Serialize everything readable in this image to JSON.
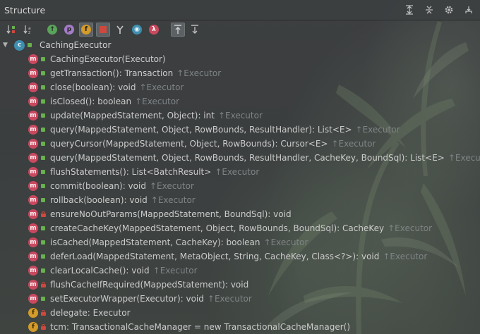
{
  "panel": {
    "title": "Structure"
  },
  "root": {
    "name": "CachingExecutor"
  },
  "members": [
    {
      "kind": "m",
      "visibility": "public",
      "signature": "CachingExecutor(Executor)",
      "inherited": ""
    },
    {
      "kind": "m",
      "visibility": "public",
      "signature": "getTransaction(): Transaction",
      "inherited": "↑Executor"
    },
    {
      "kind": "m",
      "visibility": "public",
      "signature": "close(boolean): void",
      "inherited": "↑Executor"
    },
    {
      "kind": "m",
      "visibility": "public",
      "signature": "isClosed(): boolean",
      "inherited": "↑Executor"
    },
    {
      "kind": "m",
      "visibility": "public",
      "signature": "update(MappedStatement, Object): int",
      "inherited": "↑Executor"
    },
    {
      "kind": "m",
      "visibility": "public",
      "signature": "query(MappedStatement, Object, RowBounds, ResultHandler): List<E>",
      "inherited": "↑Executor"
    },
    {
      "kind": "m",
      "visibility": "public",
      "signature": "queryCursor(MappedStatement, Object, RowBounds): Cursor<E>",
      "inherited": "↑Executor"
    },
    {
      "kind": "m",
      "visibility": "public",
      "signature": "query(MappedStatement, Object, RowBounds, ResultHandler, CacheKey, BoundSql): List<E>",
      "inherited": "↑Executor"
    },
    {
      "kind": "m",
      "visibility": "public",
      "signature": "flushStatements(): List<BatchResult>",
      "inherited": "↑Executor"
    },
    {
      "kind": "m",
      "visibility": "public",
      "signature": "commit(boolean): void",
      "inherited": "↑Executor"
    },
    {
      "kind": "m",
      "visibility": "public",
      "signature": "rollback(boolean): void",
      "inherited": "↑Executor"
    },
    {
      "kind": "m",
      "visibility": "private",
      "signature": "ensureNoOutParams(MappedStatement, BoundSql): void",
      "inherited": ""
    },
    {
      "kind": "m",
      "visibility": "public",
      "signature": "createCacheKey(MappedStatement, Object, RowBounds, BoundSql): CacheKey",
      "inherited": "↑Executor"
    },
    {
      "kind": "m",
      "visibility": "public",
      "signature": "isCached(MappedStatement, CacheKey): boolean",
      "inherited": "↑Executor"
    },
    {
      "kind": "m",
      "visibility": "public",
      "signature": "deferLoad(MappedStatement, MetaObject, String, CacheKey, Class<?>): void",
      "inherited": "↑Executor"
    },
    {
      "kind": "m",
      "visibility": "public",
      "signature": "clearLocalCache(): void",
      "inherited": "↑Executor"
    },
    {
      "kind": "m",
      "visibility": "private",
      "signature": "flushCacheIfRequired(MappedStatement): void",
      "inherited": ""
    },
    {
      "kind": "m",
      "visibility": "public",
      "signature": "setExecutorWrapper(Executor): void",
      "inherited": "↑Executor"
    },
    {
      "kind": "f",
      "visibility": "private",
      "signature": "delegate: Executor",
      "inherited": ""
    },
    {
      "kind": "f",
      "visibility": "private",
      "signature": "tcm: TransactionalCacheManager = new TransactionalCacheManager()",
      "inherited": ""
    }
  ]
}
